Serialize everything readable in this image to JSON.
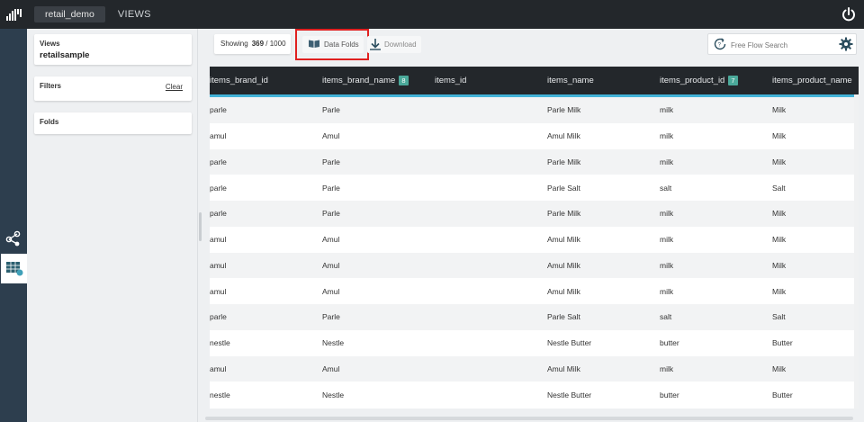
{
  "app": {
    "tab_active": "retail_demo",
    "tab_views": "VIEWS"
  },
  "sidebar": {
    "views_label": "Views",
    "views_value": "retailsample",
    "filters_label": "Filters",
    "clear_label": "Clear",
    "folds_label": "Folds"
  },
  "toolbar": {
    "showing_label": "Showing",
    "showing_count": "369",
    "showing_total": "/ 1000",
    "data_folds_label": "Data Folds",
    "download_label": "Download",
    "search_placeholder": "Free Flow Search"
  },
  "table": {
    "columns": [
      {
        "label": "items_brand_id",
        "badge": ""
      },
      {
        "label": "items_brand_name",
        "badge": "8"
      },
      {
        "label": "items_id",
        "badge": ""
      },
      {
        "label": "items_name",
        "badge": ""
      },
      {
        "label": "items_product_id",
        "badge": "7"
      },
      {
        "label": "items_product_name",
        "badge": ""
      }
    ],
    "rows": [
      [
        "parle",
        "Parle",
        "",
        "Parle Milk",
        "milk",
        "Milk"
      ],
      [
        "amul",
        "Amul",
        "",
        "Amul Milk",
        "milk",
        "Milk"
      ],
      [
        "parle",
        "Parle",
        "",
        "Parle Milk",
        "milk",
        "Milk"
      ],
      [
        "parle",
        "Parle",
        "",
        "Parle Salt",
        "salt",
        "Salt"
      ],
      [
        "parle",
        "Parle",
        "",
        "Parle Milk",
        "milk",
        "Milk"
      ],
      [
        "amul",
        "Amul",
        "",
        "Amul Milk",
        "milk",
        "Milk"
      ],
      [
        "amul",
        "Amul",
        "",
        "Amul Milk",
        "milk",
        "Milk"
      ],
      [
        "amul",
        "Amul",
        "",
        "Amul Milk",
        "milk",
        "Milk"
      ],
      [
        "parle",
        "Parle",
        "",
        "Parle Salt",
        "salt",
        "Salt"
      ],
      [
        "nestle",
        "Nestle",
        "",
        "Nestle Butter",
        "butter",
        "Butter"
      ],
      [
        "amul",
        "Amul",
        "",
        "Amul Milk",
        "milk",
        "Milk"
      ],
      [
        "nestle",
        "Nestle",
        "",
        "Nestle Butter",
        "butter",
        "Butter"
      ]
    ]
  },
  "colors": {
    "topbar": "#23272b",
    "rail": "#2d3e4e",
    "header_accent": "#43b3d8",
    "badge": "#4ba99a",
    "highlight": "#e02020"
  },
  "icons": {
    "logo": "bar-logo-icon",
    "power": "power-icon",
    "share": "share-nodes-icon",
    "table": "table-grid-icon",
    "folds": "book-open-icon",
    "download": "download-icon",
    "search": "refresh-search-icon",
    "settings": "gear-icon"
  }
}
